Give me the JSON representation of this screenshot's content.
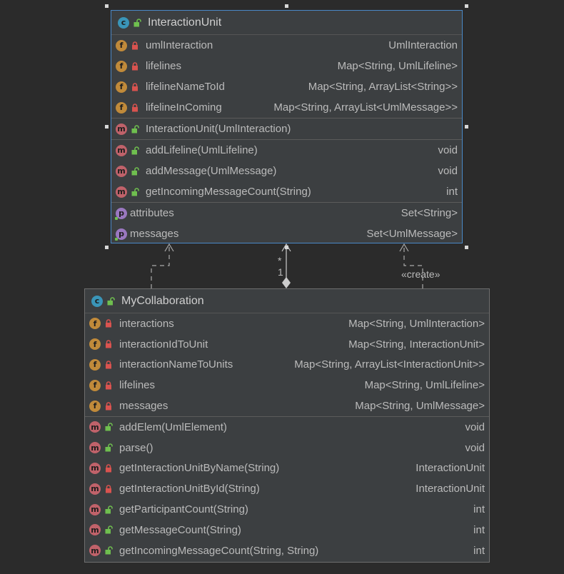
{
  "interaction_unit": {
    "name": "InteractionUnit",
    "kind_icon": "class-icon",
    "fields": [
      {
        "name": "umlInteraction",
        "type": "UmlInteraction",
        "visibility": "private"
      },
      {
        "name": "lifelines",
        "type": "Map<String, UmlLifeline>",
        "visibility": "private"
      },
      {
        "name": "lifelineNameToId",
        "type": "Map<String, ArrayList<String>>",
        "visibility": "private"
      },
      {
        "name": "lifelineInComing",
        "type": "Map<String, ArrayList<UmlMessage>>",
        "visibility": "private"
      }
    ],
    "constructors": [
      {
        "name": "InteractionUnit(UmlInteraction)",
        "type": "",
        "visibility": "public"
      }
    ],
    "methods": [
      {
        "name": "addLifeline(UmlLifeline)",
        "type": "void",
        "visibility": "public"
      },
      {
        "name": "addMessage(UmlMessage)",
        "type": "void",
        "visibility": "public"
      },
      {
        "name": "getIncomingMessageCount(String)",
        "type": "int",
        "visibility": "public"
      }
    ],
    "properties": [
      {
        "name": "attributes",
        "type": "Set<String>"
      },
      {
        "name": "messages",
        "type": "Set<UmlMessage>"
      }
    ]
  },
  "my_collaboration": {
    "name": "MyCollaboration",
    "kind_icon": "class-icon",
    "fields": [
      {
        "name": "interactions",
        "type": "Map<String, UmlInteraction>",
        "visibility": "private"
      },
      {
        "name": "interactionIdToUnit",
        "type": "Map<String, InteractionUnit>",
        "visibility": "private"
      },
      {
        "name": "interactionNameToUnits",
        "type": "Map<String, ArrayList<InteractionUnit>>",
        "visibility": "private"
      },
      {
        "name": "lifelines",
        "type": "Map<String, UmlLifeline>",
        "visibility": "private"
      },
      {
        "name": "messages",
        "type": "Map<String, UmlMessage>",
        "visibility": "private"
      }
    ],
    "methods": [
      {
        "name": "addElem(UmlElement)",
        "type": "void",
        "visibility": "public"
      },
      {
        "name": "parse()",
        "type": "void",
        "visibility": "public"
      },
      {
        "name": "getInteractionUnitByName(String)",
        "type": "InteractionUnit",
        "visibility": "private"
      },
      {
        "name": "getInteractionUnitById(String)",
        "type": "InteractionUnit",
        "visibility": "private"
      },
      {
        "name": "getParticipantCount(String)",
        "type": "int",
        "visibility": "public"
      },
      {
        "name": "getMessageCount(String)",
        "type": "int",
        "visibility": "public"
      },
      {
        "name": "getIncomingMessageCount(String, String)",
        "type": "int",
        "visibility": "public"
      }
    ]
  },
  "relations": {
    "composition_multiplicity_target": "*",
    "composition_multiplicity_source": "1",
    "create_stereotype": "«create»"
  },
  "colors": {
    "background": "#2b2b2b",
    "box_fill": "#3c3f41",
    "selected_border": "#4a88c7",
    "field_badge": "#c08a3a",
    "method_badge": "#c0626a",
    "class_badge": "#3a95b8",
    "property_badge": "#9a78c0",
    "private_lock": "#d9534f",
    "public_lock": "#6fbf4f"
  }
}
